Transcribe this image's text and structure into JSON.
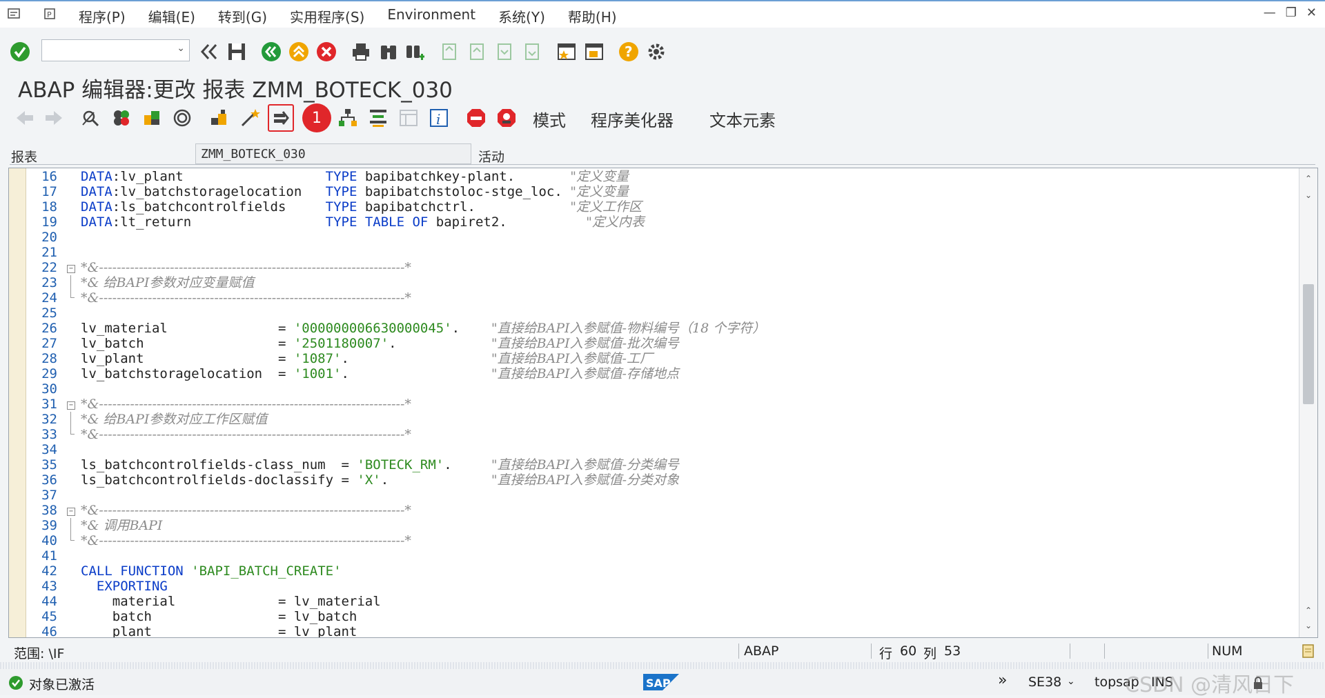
{
  "menu": {
    "items": [
      "程序(P)",
      "编辑(E)",
      "转到(G)",
      "实用程序(S)",
      "Environment",
      "系统(Y)",
      "帮助(H)"
    ]
  },
  "command_field": {
    "value": ""
  },
  "title": "ABAP 编辑器:更改 报表 ZMM_BOTECK_030",
  "toolbar2": {
    "badge": "1",
    "texts": [
      "模式",
      "程序美化器",
      "文本元素"
    ]
  },
  "report": {
    "label": "报表",
    "name": "ZMM_BOTECK_030",
    "status": "活动"
  },
  "editor": {
    "lines": [
      {
        "no": "16",
        "mark": "",
        "parts": [
          [
            "kw",
            "DATA"
          ],
          [
            "tx",
            ":lv_plant                  "
          ],
          [
            "kw",
            "TYPE"
          ],
          [
            "tx",
            " bapibatchkey-plant.       "
          ],
          [
            "cm",
            "\"定义变量"
          ]
        ]
      },
      {
        "no": "17",
        "mark": "",
        "parts": [
          [
            "kw",
            "DATA"
          ],
          [
            "tx",
            ":lv_batchstoragelocation   "
          ],
          [
            "kw",
            "TYPE"
          ],
          [
            "tx",
            " bapibatchstoloc-stge_loc. "
          ],
          [
            "cm",
            "\"定义变量"
          ]
        ]
      },
      {
        "no": "18",
        "mark": "",
        "parts": [
          [
            "kw",
            "DATA"
          ],
          [
            "tx",
            ":ls_batchcontrolfields     "
          ],
          [
            "kw",
            "TYPE"
          ],
          [
            "tx",
            " bapibatchctrl.            "
          ],
          [
            "cm",
            "\"定义工作区"
          ]
        ]
      },
      {
        "no": "19",
        "mark": "",
        "parts": [
          [
            "kw",
            "DATA"
          ],
          [
            "tx",
            ":lt_return                 "
          ],
          [
            "kw",
            "TYPE TABLE OF"
          ],
          [
            "tx",
            " bapiret2.          "
          ],
          [
            "cm",
            "\"定义内表"
          ]
        ]
      },
      {
        "no": "20",
        "mark": "",
        "parts": []
      },
      {
        "no": "21",
        "mark": "",
        "parts": []
      },
      {
        "no": "22",
        "mark": "box",
        "parts": [
          [
            "cm",
            "*&---------------------------------------------------------------------*"
          ]
        ]
      },
      {
        "no": "23",
        "mark": "line",
        "parts": [
          [
            "cm",
            "*& 给BAPI参数对应变量赋值"
          ]
        ]
      },
      {
        "no": "24",
        "mark": "end",
        "parts": [
          [
            "cm",
            "*&---------------------------------------------------------------------*"
          ]
        ]
      },
      {
        "no": "25",
        "mark": "",
        "parts": []
      },
      {
        "no": "26",
        "mark": "",
        "parts": [
          [
            "tx",
            "lv_material              = "
          ],
          [
            "st",
            "'000000006630000045'"
          ],
          [
            "tx",
            ".    "
          ],
          [
            "cm",
            "\"直接给BAPI入参赋值-物料编号（18 个字符）"
          ]
        ]
      },
      {
        "no": "27",
        "mark": "",
        "parts": [
          [
            "tx",
            "lv_batch                 = "
          ],
          [
            "st",
            "'2501180007'"
          ],
          [
            "tx",
            ".            "
          ],
          [
            "cm",
            "\"直接给BAPI入参赋值-批次编号"
          ]
        ]
      },
      {
        "no": "28",
        "mark": "",
        "parts": [
          [
            "tx",
            "lv_plant                 = "
          ],
          [
            "st",
            "'1087'"
          ],
          [
            "tx",
            ".                  "
          ],
          [
            "cm",
            "\"直接给BAPI入参赋值-工厂"
          ]
        ]
      },
      {
        "no": "29",
        "mark": "",
        "parts": [
          [
            "tx",
            "lv_batchstoragelocation  = "
          ],
          [
            "st",
            "'1001'"
          ],
          [
            "tx",
            ".                  "
          ],
          [
            "cm",
            "\"直接给BAPI入参赋值-存储地点"
          ]
        ]
      },
      {
        "no": "30",
        "mark": "",
        "parts": []
      },
      {
        "no": "31",
        "mark": "box",
        "parts": [
          [
            "cm",
            "*&---------------------------------------------------------------------*"
          ]
        ]
      },
      {
        "no": "32",
        "mark": "line",
        "parts": [
          [
            "cm",
            "*& 给BAPI参数对应工作区赋值"
          ]
        ]
      },
      {
        "no": "33",
        "mark": "end",
        "parts": [
          [
            "cm",
            "*&---------------------------------------------------------------------*"
          ]
        ]
      },
      {
        "no": "34",
        "mark": "",
        "parts": []
      },
      {
        "no": "35",
        "mark": "",
        "parts": [
          [
            "tx",
            "ls_batchcontrolfields-class_num  = "
          ],
          [
            "st",
            "'BOTECK_RM'"
          ],
          [
            "tx",
            ".     "
          ],
          [
            "cm",
            "\"直接给BAPI入参赋值-分类编号"
          ]
        ]
      },
      {
        "no": "36",
        "mark": "",
        "parts": [
          [
            "tx",
            "ls_batchcontrolfields-doclassify = "
          ],
          [
            "st",
            "'X'"
          ],
          [
            "tx",
            ".             "
          ],
          [
            "cm",
            "\"直接给BAPI入参赋值-分类对象"
          ]
        ]
      },
      {
        "no": "37",
        "mark": "",
        "parts": []
      },
      {
        "no": "38",
        "mark": "box",
        "parts": [
          [
            "cm",
            "*&---------------------------------------------------------------------*"
          ]
        ]
      },
      {
        "no": "39",
        "mark": "line",
        "parts": [
          [
            "cm",
            "*& 调用BAPI"
          ]
        ]
      },
      {
        "no": "40",
        "mark": "end",
        "parts": [
          [
            "cm",
            "*&---------------------------------------------------------------------*"
          ]
        ]
      },
      {
        "no": "41",
        "mark": "",
        "parts": []
      },
      {
        "no": "42",
        "mark": "",
        "parts": [
          [
            "kw",
            "CALL FUNCTION"
          ],
          [
            "tx",
            " "
          ],
          [
            "st",
            "'BAPI_BATCH_CREATE'"
          ]
        ]
      },
      {
        "no": "43",
        "mark": "",
        "parts": [
          [
            "kw",
            "  EXPORTING"
          ]
        ]
      },
      {
        "no": "44",
        "mark": "",
        "parts": [
          [
            "tx",
            "    material             = lv_material"
          ]
        ]
      },
      {
        "no": "45",
        "mark": "",
        "parts": [
          [
            "tx",
            "    batch                = lv_batch"
          ]
        ]
      },
      {
        "no": "46",
        "mark": "",
        "parts": [
          [
            "tx",
            "    plant                = lv_plant"
          ]
        ]
      }
    ]
  },
  "statusline": {
    "scope": "范围: \\IF",
    "lang": "ABAP",
    "row_label": "行",
    "row": "60",
    "col_label": "列",
    "col": "53",
    "num": "NUM"
  },
  "msgbar": {
    "message": "对象已激活",
    "tcode": "SE38",
    "server": "topsap",
    "mode": "INS",
    "watermark": "CSDN @清风日下"
  },
  "colors": {
    "ok_green": "#2e9b2e",
    "keyword": "#0a3cc8",
    "string": "#2d8a1f",
    "comment": "#8b8b8b",
    "highlight": "#e0262a"
  }
}
